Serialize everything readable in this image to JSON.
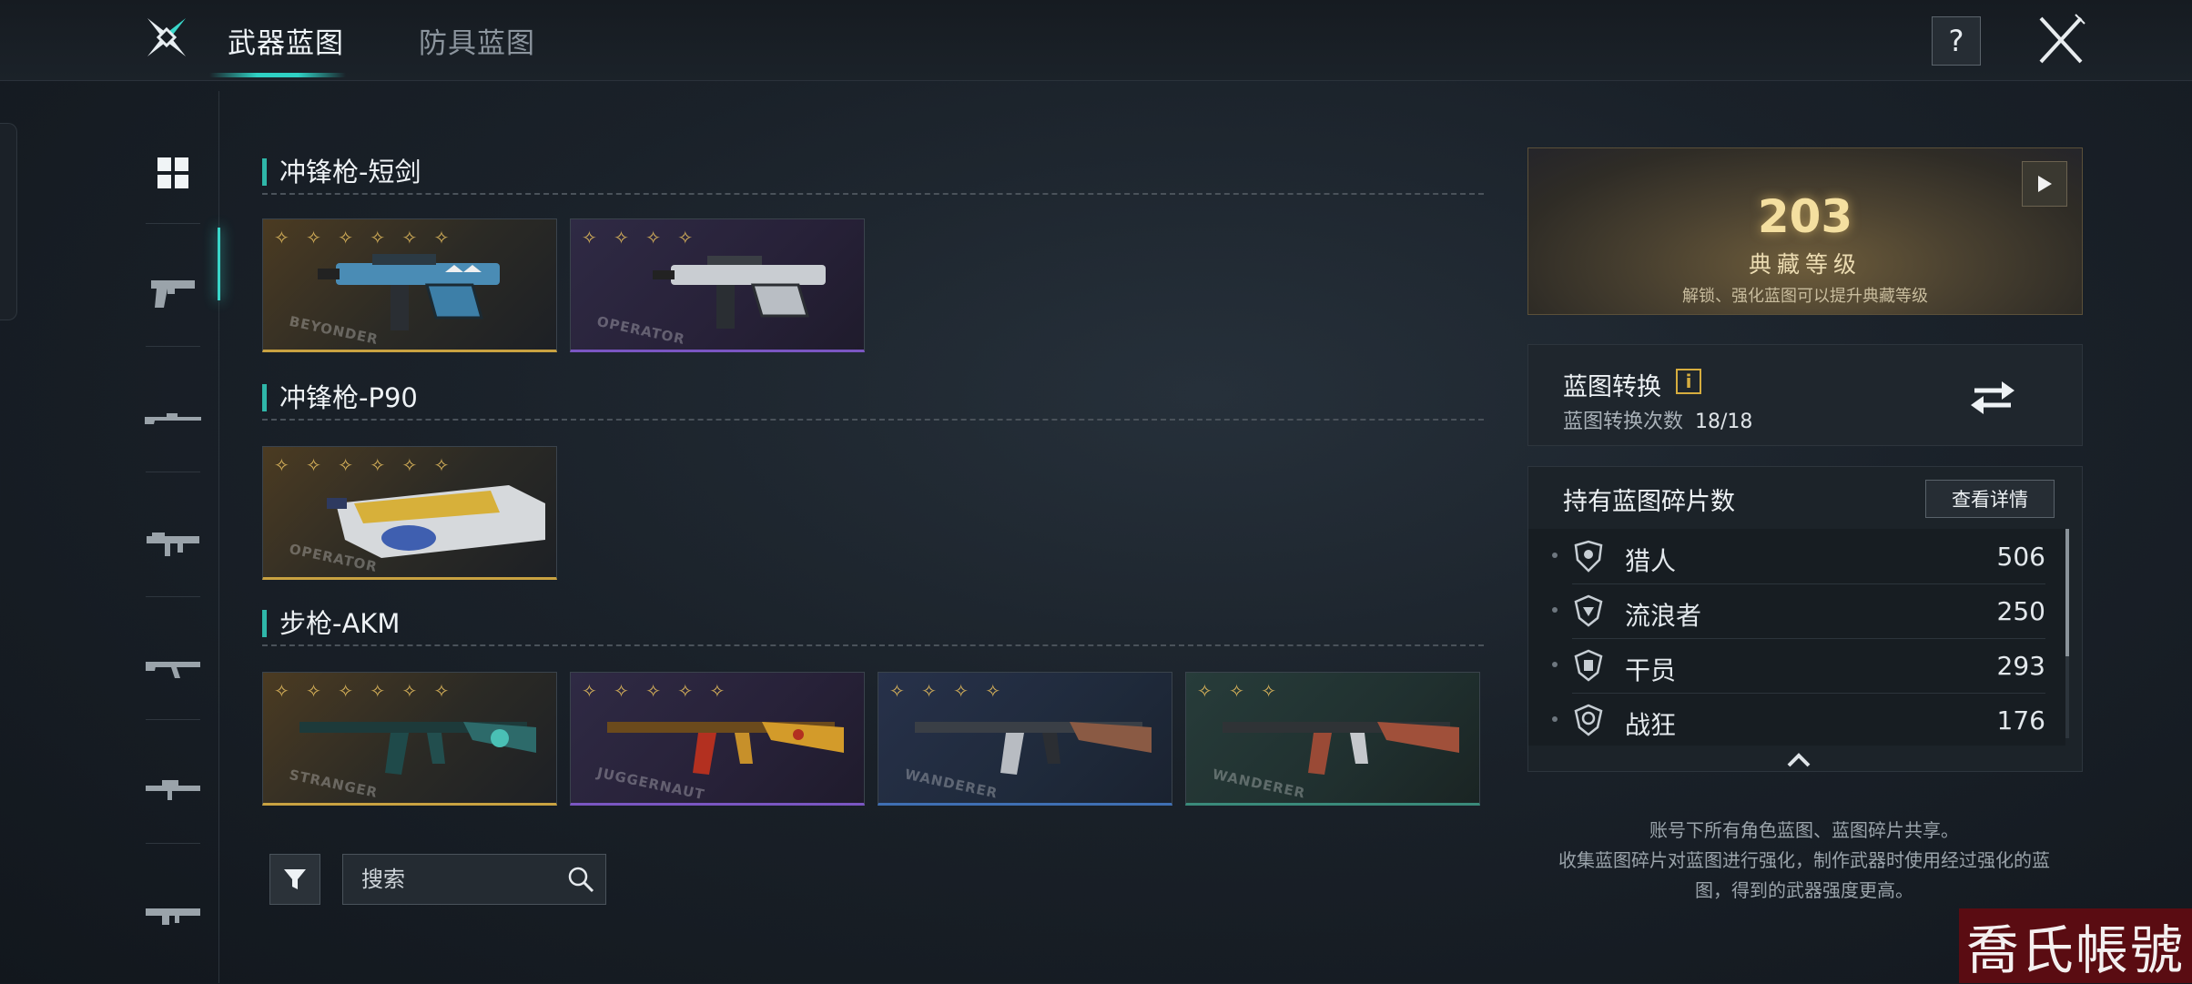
{
  "header": {
    "tabs": [
      {
        "label": "武器蓝图",
        "active": true
      },
      {
        "label": "防具蓝图",
        "active": false
      }
    ],
    "help_label": "?",
    "accent_color": "#2fd1c4"
  },
  "sidebar": {
    "categories": [
      "all-grid",
      "pistol",
      "sniper",
      "smg",
      "rifle",
      "marksman",
      "lmg"
    ]
  },
  "sections": [
    {
      "title": "冲锋枪-短剑",
      "cards": [
        {
          "stars": "✧ ✧ ✧ ✧ ✧ ✧",
          "brand": "BEYONDER",
          "rarity": "gold"
        },
        {
          "stars": "✧ ✧ ✧ ✧",
          "brand": "OPERATOR",
          "rarity": "purple"
        }
      ]
    },
    {
      "title": "冲锋枪-P90",
      "cards": [
        {
          "stars": "✧ ✧ ✧ ✧ ✧ ✧",
          "brand": "OPERATOR",
          "rarity": "gold"
        }
      ]
    },
    {
      "title": "步枪-AKM",
      "cards": [
        {
          "stars": "✧ ✧ ✧ ✧ ✧ ✧",
          "brand": "STRANGER",
          "rarity": "gold"
        },
        {
          "stars": "✧ ✧ ✧ ✧ ✧",
          "brand": "JUGGERNAUT",
          "rarity": "purple"
        },
        {
          "stars": "✧ ✧ ✧ ✧",
          "brand": "WANDERER",
          "rarity": "blue"
        },
        {
          "stars": "✧ ✧ ✧",
          "brand": "WANDERER",
          "rarity": "green"
        }
      ]
    }
  ],
  "search": {
    "placeholder": "搜索"
  },
  "collection": {
    "level": "203",
    "label": "典藏等级",
    "hint": "解锁、强化蓝图可以提升典藏等级"
  },
  "convert": {
    "title": "蓝图转换",
    "info_icon": "i",
    "count_label": "蓝图转换次数",
    "count_value": "18/18"
  },
  "fragments": {
    "title": "持有蓝图碎片数",
    "detail_button": "查看详情",
    "items": [
      {
        "name": "猎人",
        "count": "506"
      },
      {
        "name": "流浪者",
        "count": "250"
      },
      {
        "name": "干员",
        "count": "293"
      },
      {
        "name": "战狂",
        "count": "176"
      }
    ]
  },
  "notes": {
    "line1": "账号下所有角色蓝图、蓝图碎片共享。",
    "line2": "收集蓝图碎片对蓝图进行强化，制作武器时使用经过强化的蓝",
    "line3": "图，得到的武器强度更高。"
  },
  "watermark": "喬氏帳號"
}
